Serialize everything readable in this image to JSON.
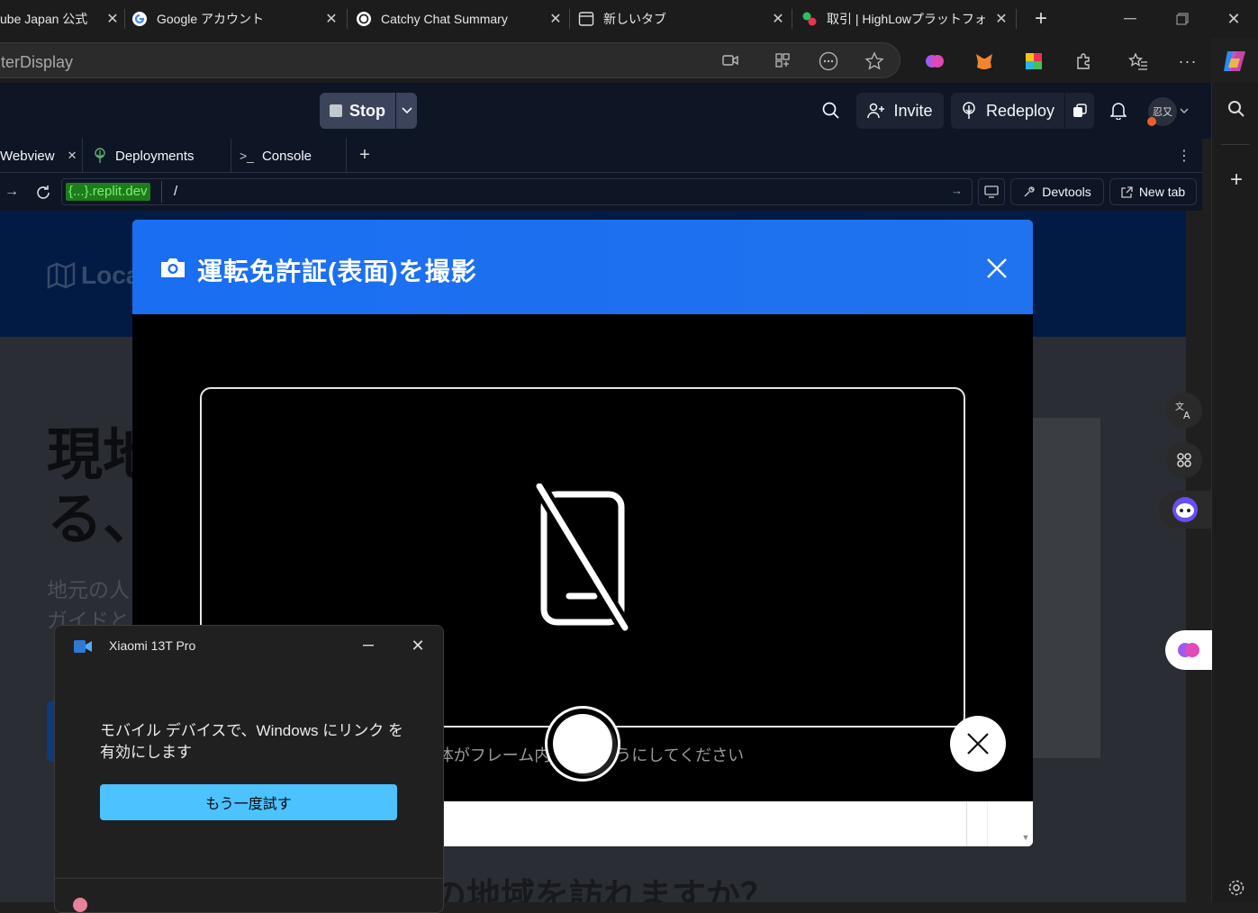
{
  "browser": {
    "tabs": [
      {
        "title": "ube Japan 公式",
        "icon": "youtube-icon"
      },
      {
        "title": "Google アカウント",
        "icon": "google-icon"
      },
      {
        "title": "Catchy Chat Summary",
        "icon": "openai-icon"
      },
      {
        "title": "新しいタブ",
        "icon": "new-tab-icon"
      },
      {
        "title": "取引 | HighLowプラットフォ",
        "icon": "highlow-icon"
      }
    ],
    "address": "terDisplay"
  },
  "replit": {
    "stop_label": "Stop",
    "invite_label": "Invite",
    "redeploy_label": "Redeploy",
    "avatar_text": "忍又",
    "pane_tabs": [
      {
        "label": "Webview"
      },
      {
        "label": "Deployments"
      },
      {
        "label": "Console"
      }
    ],
    "url_domain": "{...}.replit.dev",
    "url_path": "/",
    "devtools_label": "Devtools",
    "newtab_label": "New tab"
  },
  "webpage": {
    "logo_text": "Loca",
    "hero_line1": "現地",
    "hero_line2": "る、",
    "sub_line1": "地元の人",
    "sub_line2": "ガイドと",
    "bottom_heading": "の地域を訪れますか？"
  },
  "modal": {
    "title": "運転免許証(表面)を撮影",
    "hint": "全体がフレーム内に入るようにしてください"
  },
  "phone_link": {
    "title": "Xiaomi 13T Pro",
    "message": "モバイル デバイスで、Windows にリンク を有効にします",
    "retry_label": "もう一度試す"
  },
  "colors": {
    "modal_header": "#1a6ef2",
    "replit_bg": "#0e1525",
    "retry_button": "#4cc2ff"
  }
}
